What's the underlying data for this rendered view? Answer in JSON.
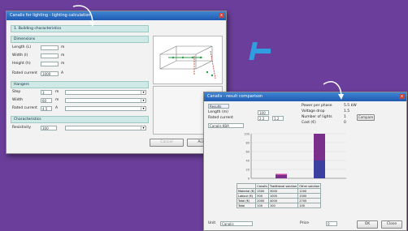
{
  "colors": {
    "background": "#6a3e9a",
    "plus": "#2f9de0",
    "accent_title": "#1e5ab0",
    "section": "#cfe9e6",
    "bar_purple": "#7a2f8c",
    "bar_pink": "#d8449c",
    "bar_blue": "#3a3fa0"
  },
  "window1": {
    "title": "Canalis for lighting - lighting calculation",
    "close": "x",
    "heading": "1. Building characteristics",
    "section_dim": "Dimensions",
    "length_label": "Length (L)",
    "width_label": "Width (l)",
    "height_label": "Height (h)",
    "length_value": "",
    "width_value": "",
    "height_value": "",
    "unit_m": "m",
    "power_label": "Rated current",
    "power_value": "1000",
    "power_unit": "A",
    "section_2": "Hangers",
    "row1_label": "Step",
    "row1_value": "3",
    "row1_unit": "m",
    "row2_label": "Width",
    "row2_value": "60",
    "row2_unit": "m",
    "row3_label": "Rated current",
    "row3_value": "4.5",
    "row3_unit": "A",
    "section_3": "Characteristics",
    "row4_label": "Resistivity",
    "row4_value": "300",
    "cancel": "Cancel",
    "accept": "Accept"
  },
  "window2": {
    "title": "Canalis - result comparison",
    "tab": "Results",
    "field1_label": "Length (m)",
    "field1_value": "100",
    "field2_label": "Rated current",
    "field2_value": "2.2",
    "field3_value": "1.2",
    "dropdown_value": "Canalis KBA",
    "r1_label": "Power per phase",
    "r1_value": "5.5 kW",
    "r2_label": "Voltage drop",
    "r2_value": "1.5",
    "r3_label": "Number of lights",
    "r3_value": "1",
    "r4_label": "Cost (€)",
    "r4_value": "0",
    "side_btn": "Compare",
    "ticks": [
      "100",
      "80",
      "60",
      "40",
      "20",
      "0"
    ],
    "table_head": [
      "",
      "Canalis",
      "Traditional solution",
      "Other solution"
    ],
    "table_rows": [
      [
        "Material (€)",
        "1500",
        "3000",
        "1200"
      ],
      [
        "Labour (€)",
        "500",
        "1000",
        "1500"
      ],
      [
        "Total (€)",
        "2000",
        "4000",
        "2700"
      ],
      [
        "Total",
        "100",
        "100",
        "100"
      ]
    ],
    "footer_label": "Unit",
    "footer_value": "Canalis",
    "footer_label2": "Price",
    "footer_value2": "0",
    "ok": "OK",
    "close_btn": "Close"
  },
  "chart_data": {
    "type": "bar",
    "categories": [
      "Canalis",
      "Traditional solution"
    ],
    "series": [
      {
        "name": "",
        "values": [
          8,
          40
        ]
      },
      {
        "name": "",
        "values": [
          2,
          60
        ]
      }
    ],
    "ylim": [
      0,
      100
    ]
  }
}
